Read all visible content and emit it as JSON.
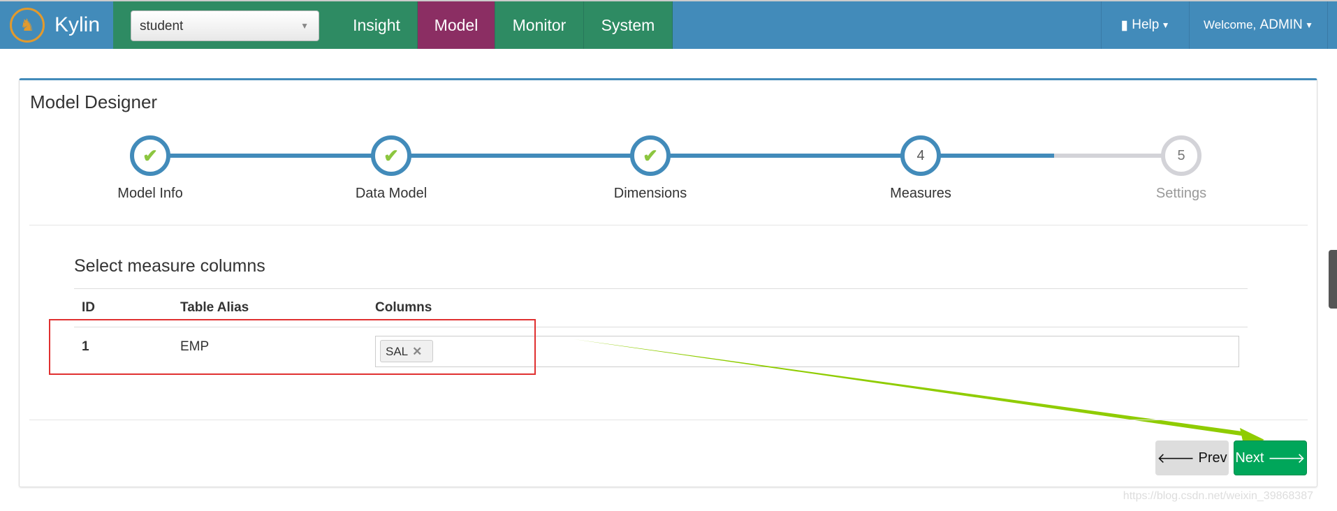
{
  "nav": {
    "brand": "Kylin",
    "project": "student",
    "tabs": [
      "Insight",
      "Model",
      "Monitor",
      "System"
    ],
    "active_tab": "Model",
    "help": "Help",
    "welcome": "Welcome,",
    "user": "ADMIN"
  },
  "panel": {
    "title": "Model Designer"
  },
  "steps": [
    {
      "num": "1",
      "label": "Model Info",
      "state": "done"
    },
    {
      "num": "2",
      "label": "Data Model",
      "state": "done"
    },
    {
      "num": "3",
      "label": "Dimensions",
      "state": "done"
    },
    {
      "num": "4",
      "label": "Measures",
      "state": "current"
    },
    {
      "num": "5",
      "label": "Settings",
      "state": "todo"
    }
  ],
  "section": {
    "title": "Select measure columns",
    "headers": [
      "ID",
      "Table Alias",
      "Columns"
    ],
    "rows": [
      {
        "id": "1",
        "alias": "EMP",
        "columns": [
          "SAL"
        ]
      }
    ]
  },
  "buttons": {
    "prev": "Prev",
    "next": "Next"
  },
  "watermark": "https://blog.csdn.net/weixin_39868387",
  "colors": {
    "nav": "#428bba",
    "tab": "#2e8b63",
    "active_tab": "#8b2e63",
    "next": "#00a65a",
    "annotation_box": "#e03030",
    "annotation_arrow": "#8fcc00"
  }
}
